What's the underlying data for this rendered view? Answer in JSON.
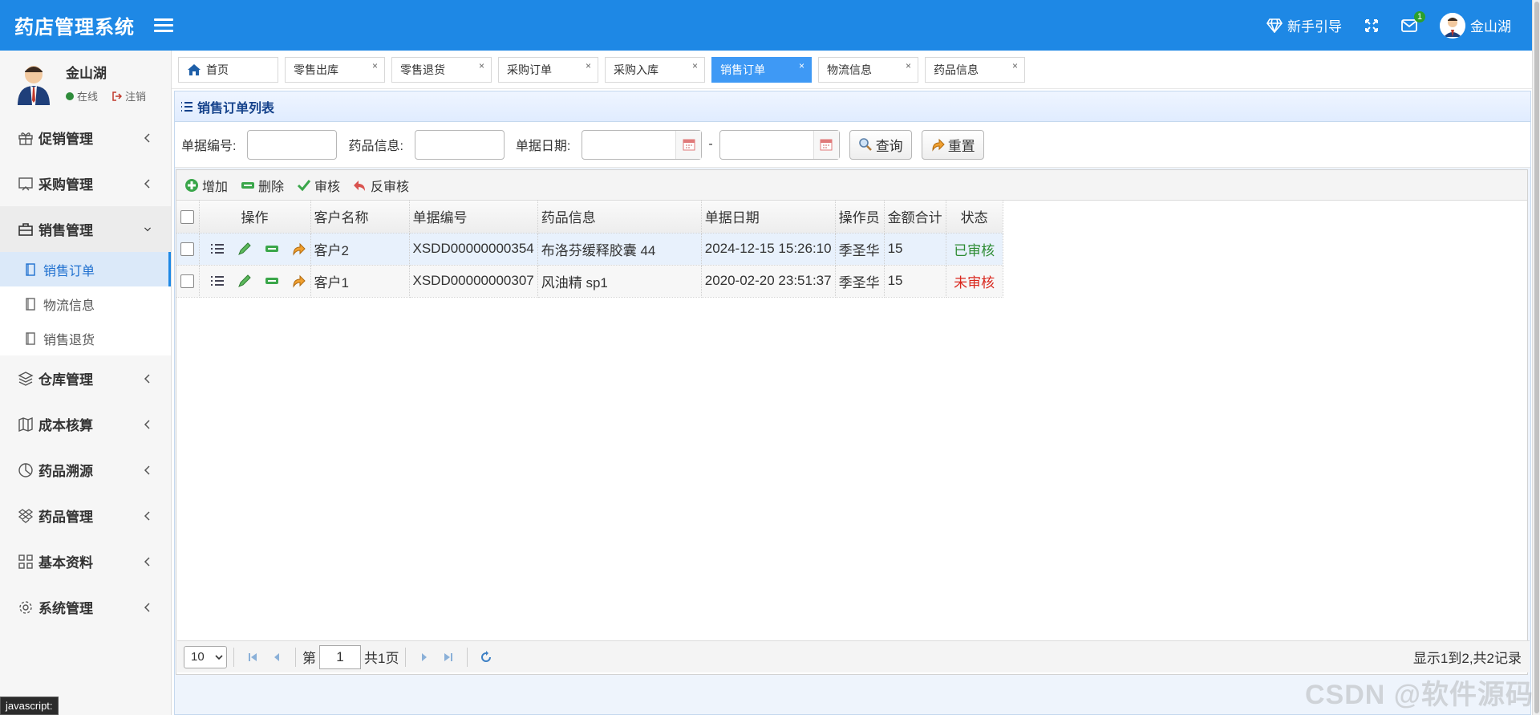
{
  "header": {
    "title": "药店管理系统",
    "guide": "新手引导",
    "mail_badge": "1",
    "user": "金山湖"
  },
  "sidebar": {
    "user_name": "金山湖",
    "status": "在线",
    "logout": "注销",
    "menus": {
      "promo": "促销管理",
      "purchase": "采购管理",
      "sales": "销售管理",
      "warehouse": "仓库管理",
      "cost": "成本核算",
      "trace": "药品溯源",
      "drug": "药品管理",
      "basic": "基本资料",
      "system": "系统管理"
    },
    "sales_sub": {
      "order": "销售订单",
      "logistics": "物流信息",
      "return": "销售退货"
    }
  },
  "tabs": {
    "home": "首页",
    "t1": "零售出库",
    "t2": "零售退货",
    "t3": "采购订单",
    "t4": "采购入库",
    "t5": "销售订单",
    "t6": "物流信息",
    "t7": "药品信息",
    "close": "×"
  },
  "panel": {
    "title": "销售订单列表"
  },
  "search": {
    "code_label": "单据编号:",
    "drug_label": "药品信息:",
    "date_label": "单据日期:",
    "dash": "-",
    "query": "查询",
    "reset": "重置"
  },
  "toolbar": {
    "add": "增加",
    "delete": "删除",
    "audit": "审核",
    "unaudit": "反审核"
  },
  "grid": {
    "headers": {
      "ops": "操作",
      "customer": "客户名称",
      "code": "单据编号",
      "drug": "药品信息",
      "date": "单据日期",
      "operator": "操作员",
      "amount": "金额合计",
      "status": "状态"
    },
    "rows": [
      {
        "customer": "客户2",
        "code": "XSDD00000000354",
        "drug": "布洛芬缓释胶囊 44",
        "date": "2024-12-15 15:26:10",
        "operator": "季圣华",
        "amount": "15",
        "status": "已审核"
      },
      {
        "customer": "客户1",
        "code": "XSDD00000000307",
        "drug": "风油精 sp1",
        "date": "2020-02-20 23:51:37",
        "operator": "季圣华",
        "amount": "15",
        "status": "未审核"
      }
    ]
  },
  "pager": {
    "page_size": "10",
    "page_prefix": "第",
    "page_value": "1",
    "page_suffix": "共1页",
    "info": "显示1到2,共2记录"
  },
  "statusbar": "javascript:",
  "watermark": "CSDN @软件源码",
  "colors": {
    "header": "#1e88e5",
    "active_tab": "#3e99f5",
    "approved": "#2c8b32",
    "unapproved": "#d9261c"
  }
}
